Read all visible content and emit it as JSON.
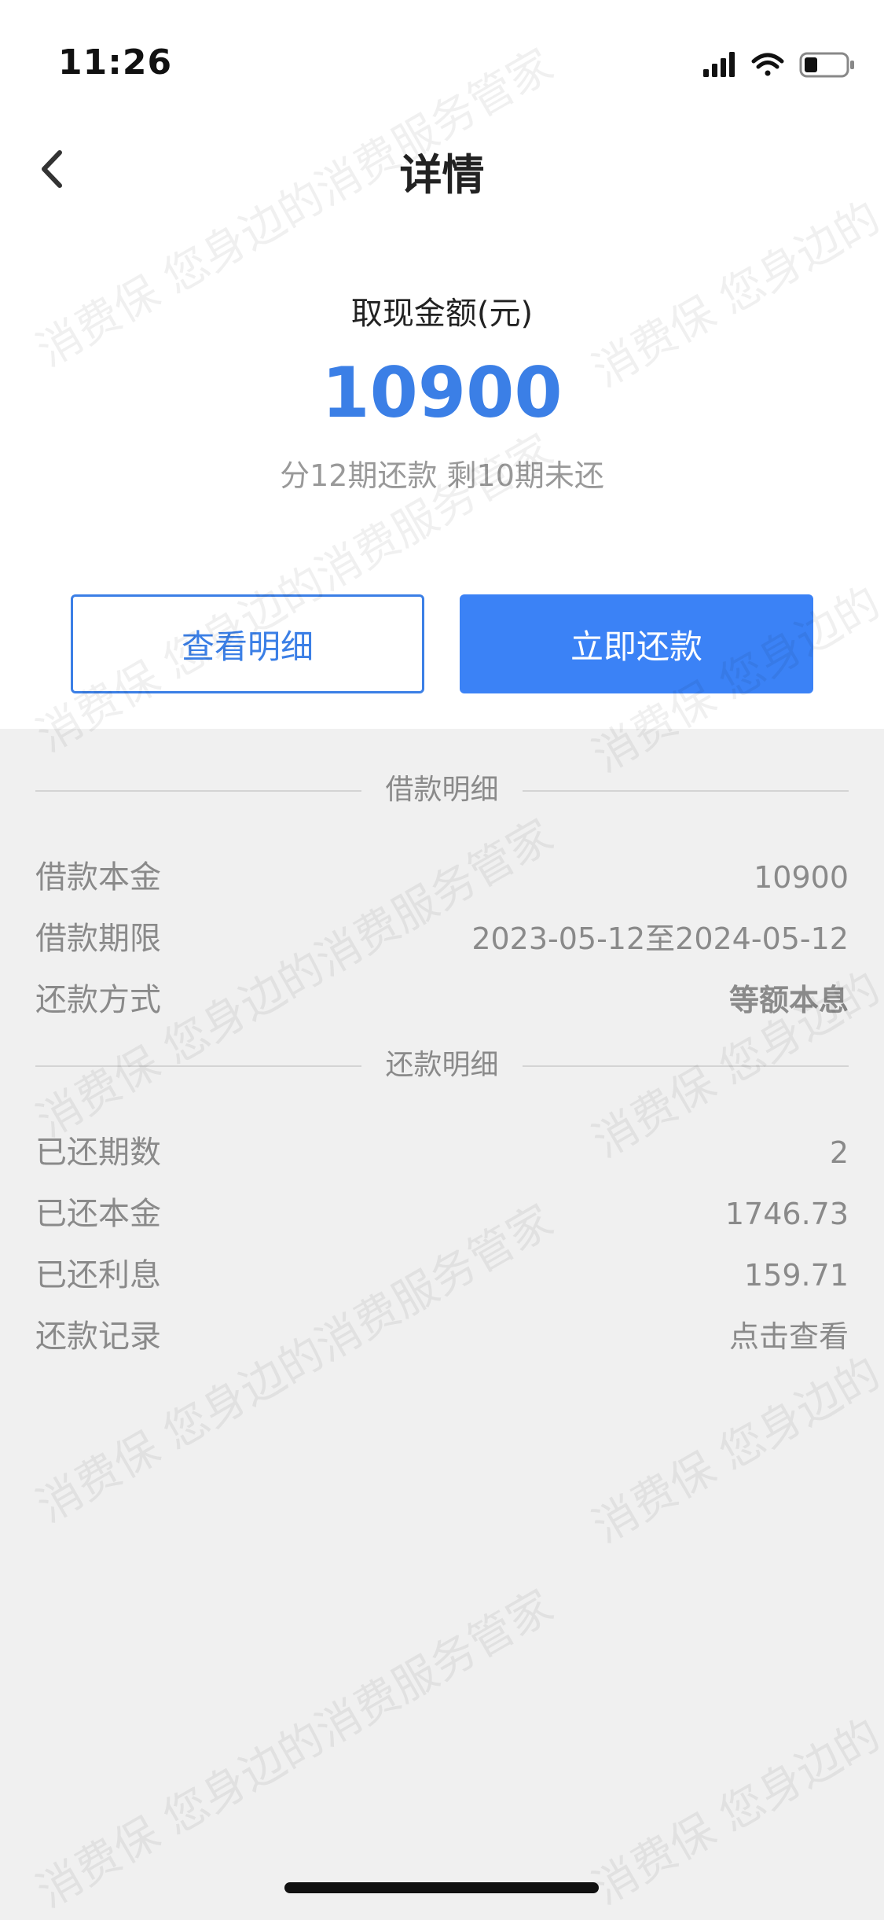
{
  "status_bar": {
    "time": "11:26",
    "icons": [
      "cellular-signal-icon",
      "wifi-icon",
      "battery-icon"
    ]
  },
  "nav": {
    "back_icon": "chevron-left-icon",
    "title": "详情"
  },
  "summary": {
    "amount_label": "取现金额(元)",
    "amount": "10900",
    "installments": "分12期还款 剩10期未还"
  },
  "actions": {
    "view_details": "查看明细",
    "repay_now": "立即还款"
  },
  "loan_details": {
    "section_title": "借款明细",
    "rows": [
      {
        "label": "借款本金",
        "value": "10900"
      },
      {
        "label": "借款期限",
        "value": "2023-05-12至2024-05-12"
      },
      {
        "label": "还款方式",
        "value": "等额本息"
      }
    ]
  },
  "repayment_details": {
    "section_title": "还款明细",
    "rows": [
      {
        "label": "已还期数",
        "value": "2"
      },
      {
        "label": "已还本金",
        "value": "1746.73"
      },
      {
        "label": "已还利息",
        "value": "159.71"
      },
      {
        "label": "还款记录",
        "value": "点击查看"
      }
    ]
  },
  "watermark": {
    "text_a": "消费保 您身边的消费服务管家",
    "text_b": "消费保 您身边的"
  },
  "colors": {
    "accent": "#3b7fe6",
    "button_fill": "#3b82f6",
    "page_bg": "#f0f0f0",
    "muted_text": "#8a8a8a"
  }
}
